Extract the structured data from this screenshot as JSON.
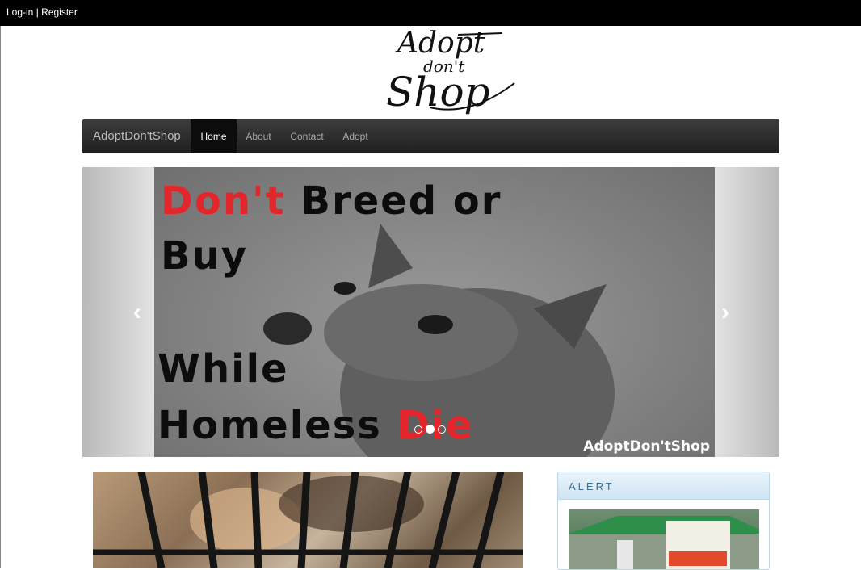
{
  "topbar": {
    "login": "Log-in",
    "separator": " | ",
    "register": "Register"
  },
  "logo": {
    "line1": "Adopt",
    "line2": "don't",
    "line3": "Shop"
  },
  "navbar": {
    "brand": "AdoptDon'tShop",
    "items": [
      {
        "label": "Home",
        "active": true
      },
      {
        "label": "About",
        "active": false
      },
      {
        "label": "Contact",
        "active": false
      },
      {
        "label": "Adopt",
        "active": false
      }
    ]
  },
  "carousel": {
    "slide": {
      "line1_red": "Don't",
      "line1_black": "Breed or",
      "line2": "Buy",
      "line3": "While",
      "line4_black": "Homeless",
      "line4_red": "Die",
      "watermark": "AdoptDon'tShop"
    },
    "prev_icon": "chevron-left-icon",
    "next_icon": "chevron-right-icon",
    "indicators": 3,
    "active_indicator": 2
  },
  "alert": {
    "title": "ALERT"
  },
  "colors": {
    "accent_red": "#e3262b",
    "navbar": "#2a2a2a",
    "alert_title": "#3b6f92"
  }
}
